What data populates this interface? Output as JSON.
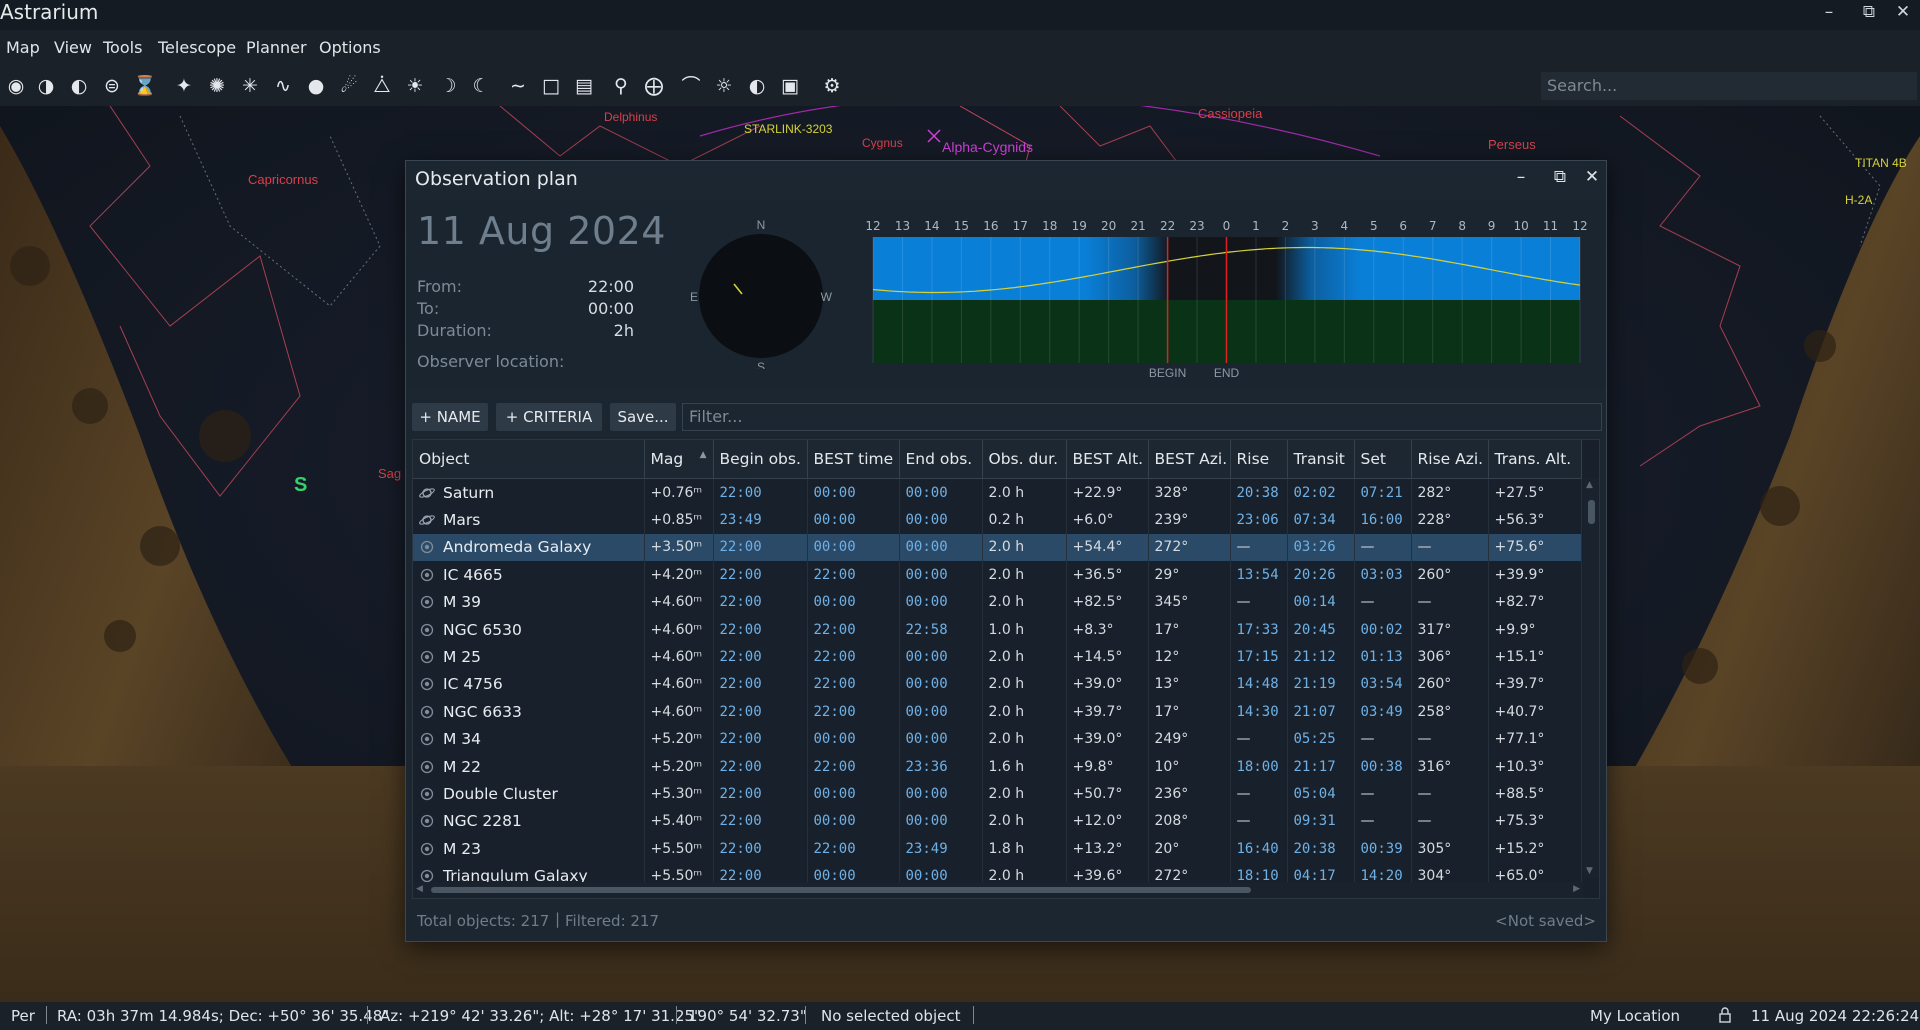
{
  "app": {
    "title": "Astrarium"
  },
  "menu": [
    "Map",
    "View",
    "Tools",
    "Telescope",
    "Planner",
    "Options"
  ],
  "toolbar": {
    "icons": [
      "owl-icon",
      "horizon-icon",
      "moon-phase-icon",
      "mirror-icon",
      "hourglass-icon",
      "stars-icon",
      "spiral-galaxy-icon",
      "star-cluster-icon",
      "milky-way-icon",
      "nebula-icon",
      "comet-icon",
      "satellite-icon",
      "sun-icon",
      "crescent-moon-icon",
      "planet-icon",
      "constellation-lines-icon",
      "constellation-borders-icon",
      "constellation-labels-icon",
      "equatorial-grid-icon",
      "horizontal-grid-icon",
      "horizon-landscape-icon",
      "atmosphere-icon",
      "light-pollution-icon",
      "ground-icon",
      "settings-gear-icon"
    ]
  },
  "search": {
    "placeholder": "Search..."
  },
  "sky_labels": {
    "delphinus": "Delphinus",
    "starlink": "STARLINK-3203",
    "cygnus": "Cygnus",
    "alpha_cygnids": "Alpha-Cygnids",
    "cassiopeia": "Cassiopeia",
    "perseus": "Perseus",
    "capricornus": "Capricornus",
    "titan": "TITAN 4B",
    "h2a": "H-2A",
    "sag": "Sag",
    "south": "S"
  },
  "dialog": {
    "title": "Observation plan",
    "date": "11 Aug 2024",
    "from_label": "From:",
    "from_value": "22:00",
    "to_label": "To:",
    "to_value": "00:00",
    "duration_label": "Duration:",
    "duration_value": "2h",
    "observer_label": "Observer location:",
    "compass": {
      "n": "N",
      "s": "S",
      "e": "E",
      "w": "W"
    },
    "timeline": {
      "hours": [
        "12",
        "13",
        "14",
        "15",
        "16",
        "17",
        "18",
        "19",
        "20",
        "21",
        "22",
        "23",
        "0",
        "1",
        "2",
        "3",
        "4",
        "5",
        "6",
        "7",
        "8",
        "9",
        "10",
        "11",
        "12"
      ],
      "begin_label": "BEGIN",
      "end_label": "END",
      "colors": {
        "day": "#0a7fd8",
        "night": "#101418",
        "ground": "#0a3216",
        "curve": "#d6d23a",
        "marker": "#e02020"
      }
    },
    "buttons": {
      "name": "+ NAME",
      "criteria": "+ CRITERIA",
      "save": "Save..."
    },
    "filter_placeholder": "Filter...",
    "columns": [
      "Object",
      "Mag",
      "Begin obs.",
      "BEST time",
      "End obs.",
      "Obs. dur.",
      "BEST Alt.",
      "BEST Azi.",
      "Rise",
      "Transit",
      "Set",
      "Rise Azi.",
      "Trans. Alt."
    ],
    "rows": [
      {
        "icon": "planet-icon",
        "object": "Saturn",
        "mag": "+0.76ᵐ",
        "begin": "22:00",
        "best": "00:00",
        "end": "00:00",
        "dur": "2.0 h",
        "best_alt": "+22.9°",
        "best_azi": "328°",
        "rise": "20:38",
        "transit": "02:02",
        "set": "07:21",
        "rise_azi": "282°",
        "trans_alt": "+27.5°"
      },
      {
        "icon": "planet-icon",
        "object": "Mars",
        "mag": "+0.85ᵐ",
        "begin": "23:49",
        "best": "00:00",
        "end": "00:00",
        "dur": "0.2 h",
        "best_alt": "+6.0°",
        "best_azi": "239°",
        "rise": "23:06",
        "transit": "07:34",
        "set": "16:00",
        "rise_azi": "228°",
        "trans_alt": "+56.3°"
      },
      {
        "icon": "deep-sky-icon",
        "object": "Andromeda Galaxy",
        "mag": "+3.50ᵐ",
        "begin": "22:00",
        "best": "00:00",
        "end": "00:00",
        "dur": "2.0 h",
        "best_alt": "+54.4°",
        "best_azi": "272°",
        "rise": "—",
        "transit": "03:26",
        "set": "—",
        "rise_azi": "—",
        "trans_alt": "+75.6°",
        "selected": true
      },
      {
        "icon": "deep-sky-icon",
        "object": "IC 4665",
        "mag": "+4.20ᵐ",
        "begin": "22:00",
        "best": "22:00",
        "end": "00:00",
        "dur": "2.0 h",
        "best_alt": "+36.5°",
        "best_azi": "29°",
        "rise": "13:54",
        "transit": "20:26",
        "set": "03:03",
        "rise_azi": "260°",
        "trans_alt": "+39.9°"
      },
      {
        "icon": "deep-sky-icon",
        "object": "M 39",
        "mag": "+4.60ᵐ",
        "begin": "22:00",
        "best": "00:00",
        "end": "00:00",
        "dur": "2.0 h",
        "best_alt": "+82.5°",
        "best_azi": "345°",
        "rise": "—",
        "transit": "00:14",
        "set": "—",
        "rise_azi": "—",
        "trans_alt": "+82.7°"
      },
      {
        "icon": "deep-sky-icon",
        "object": "NGC 6530",
        "mag": "+4.60ᵐ",
        "begin": "22:00",
        "best": "22:00",
        "end": "22:58",
        "dur": "1.0 h",
        "best_alt": "+8.3°",
        "best_azi": "17°",
        "rise": "17:33",
        "transit": "20:45",
        "set": "00:02",
        "rise_azi": "317°",
        "trans_alt": "+9.9°"
      },
      {
        "icon": "deep-sky-icon",
        "object": "M 25",
        "mag": "+4.60ᵐ",
        "begin": "22:00",
        "best": "22:00",
        "end": "00:00",
        "dur": "2.0 h",
        "best_alt": "+14.5°",
        "best_azi": "12°",
        "rise": "17:15",
        "transit": "21:12",
        "set": "01:13",
        "rise_azi": "306°",
        "trans_alt": "+15.1°"
      },
      {
        "icon": "deep-sky-icon",
        "object": "IC 4756",
        "mag": "+4.60ᵐ",
        "begin": "22:00",
        "best": "22:00",
        "end": "00:00",
        "dur": "2.0 h",
        "best_alt": "+39.0°",
        "best_azi": "13°",
        "rise": "14:48",
        "transit": "21:19",
        "set": "03:54",
        "rise_azi": "260°",
        "trans_alt": "+39.7°"
      },
      {
        "icon": "deep-sky-icon",
        "object": "NGC 6633",
        "mag": "+4.60ᵐ",
        "begin": "22:00",
        "best": "22:00",
        "end": "00:00",
        "dur": "2.0 h",
        "best_alt": "+39.7°",
        "best_azi": "17°",
        "rise": "14:30",
        "transit": "21:07",
        "set": "03:49",
        "rise_azi": "258°",
        "trans_alt": "+40.7°"
      },
      {
        "icon": "deep-sky-icon",
        "object": "M 34",
        "mag": "+5.20ᵐ",
        "begin": "22:00",
        "best": "00:00",
        "end": "00:00",
        "dur": "2.0 h",
        "best_alt": "+39.0°",
        "best_azi": "249°",
        "rise": "—",
        "transit": "05:25",
        "set": "—",
        "rise_azi": "—",
        "trans_alt": "+77.1°"
      },
      {
        "icon": "deep-sky-icon",
        "object": "M 22",
        "mag": "+5.20ᵐ",
        "begin": "22:00",
        "best": "22:00",
        "end": "23:36",
        "dur": "1.6 h",
        "best_alt": "+9.8°",
        "best_azi": "10°",
        "rise": "18:00",
        "transit": "21:17",
        "set": "00:38",
        "rise_azi": "316°",
        "trans_alt": "+10.3°"
      },
      {
        "icon": "deep-sky-icon",
        "object": "Double Cluster",
        "mag": "+5.30ᵐ",
        "begin": "22:00",
        "best": "00:00",
        "end": "00:00",
        "dur": "2.0 h",
        "best_alt": "+50.7°",
        "best_azi": "236°",
        "rise": "—",
        "transit": "05:04",
        "set": "—",
        "rise_azi": "—",
        "trans_alt": "+88.5°"
      },
      {
        "icon": "deep-sky-icon",
        "object": "NGC 2281",
        "mag": "+5.40ᵐ",
        "begin": "22:00",
        "best": "00:00",
        "end": "00:00",
        "dur": "2.0 h",
        "best_alt": "+12.0°",
        "best_azi": "208°",
        "rise": "—",
        "transit": "09:31",
        "set": "—",
        "rise_azi": "—",
        "trans_alt": "+75.3°"
      },
      {
        "icon": "deep-sky-icon",
        "object": "M 23",
        "mag": "+5.50ᵐ",
        "begin": "22:00",
        "best": "22:00",
        "end": "23:49",
        "dur": "1.8 h",
        "best_alt": "+13.2°",
        "best_azi": "20°",
        "rise": "16:40",
        "transit": "20:38",
        "set": "00:39",
        "rise_azi": "305°",
        "trans_alt": "+15.2°"
      },
      {
        "icon": "deep-sky-icon",
        "object": "Triangulum Galaxy",
        "mag": "+5.50ᵐ",
        "begin": "22:00",
        "best": "00:00",
        "end": "00:00",
        "dur": "2.0 h",
        "best_alt": "+39.6°",
        "best_azi": "272°",
        "rise": "18:10",
        "transit": "04:17",
        "set": "14:20",
        "rise_azi": "304°",
        "trans_alt": "+65.0°"
      }
    ],
    "footer": {
      "total": "Total objects: 217",
      "filtered": "Filtered: 217",
      "status": "<Not saved>"
    }
  },
  "statusbar": {
    "projection": "Per",
    "radec": "RA: 03h 37m 14.984s; Dec: +50° 36' 35.48\"",
    "altaz": "Az: +219° 42' 33.26\"; Alt: +28° 17' 31.25\"",
    "fov": "190° 54' 32.73\"",
    "selection": "No selected object",
    "location": "My Location",
    "datetime": "11 Aug 2024 22:26:24"
  }
}
